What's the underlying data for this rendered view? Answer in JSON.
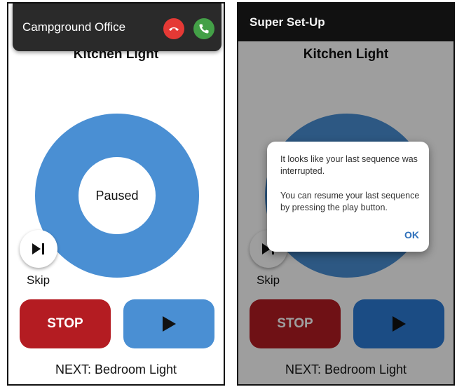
{
  "left_screen": {
    "device_title": "Kitchen Light",
    "status": "Paused",
    "skip_label": "Skip",
    "stop_label": "STOP",
    "next_label": "NEXT: Bedroom Light",
    "call_notification": {
      "caller": "Campground Office",
      "decline_icon": "phone-hangup-icon",
      "accept_icon": "phone-answer-icon"
    }
  },
  "right_screen": {
    "app_title": "Super Set-Up",
    "device_title": "Kitchen Light",
    "skip_label": "Skip",
    "stop_label": "STOP",
    "next_label": "NEXT: Bedroom Light",
    "dialog": {
      "message_1": "It looks like your last sequence was interrupted.",
      "message_2": "You can resume your last sequence by pressing the play button.",
      "ok_label": "OK"
    }
  },
  "colors": {
    "ring_blue": "#4a8fd3",
    "stop_red": "#b41c22",
    "decline_red": "#e53935",
    "accept_green": "#43a047",
    "dialog_ok_blue": "#2d6fba"
  }
}
